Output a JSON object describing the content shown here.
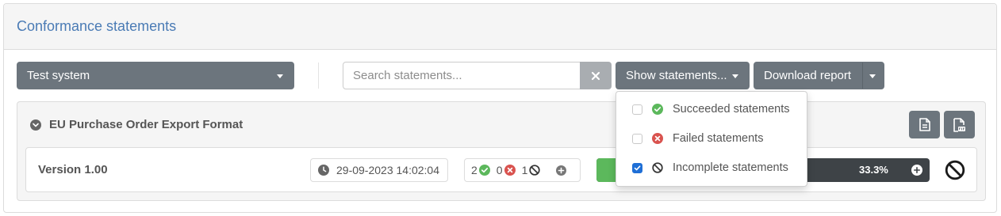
{
  "panel": {
    "title": "Conformance statements"
  },
  "toolbar": {
    "system_select": "Test system",
    "search_placeholder": "Search statements...",
    "show_statements_label": "Show statements...",
    "download_report_label": "Download report"
  },
  "specification": {
    "title": "EU Purchase Order Export Format",
    "version": "Version 1.00",
    "timestamp": "29-09-2023 14:02:04",
    "counts": {
      "succeeded": "2",
      "failed": "0",
      "incomplete": "1"
    },
    "progress": {
      "percent_label": "33.3%",
      "succeeded_fraction": 0.333
    }
  },
  "filter_menu": {
    "items": [
      {
        "label": "Succeeded statements",
        "checked": false,
        "icon": "check-circle-icon"
      },
      {
        "label": "Failed statements",
        "checked": false,
        "icon": "x-circle-icon"
      },
      {
        "label": "Incomplete statements",
        "checked": true,
        "icon": "ban-icon"
      }
    ]
  },
  "colors": {
    "accent_title": "#4a7bb5",
    "button": "#6c757d",
    "success": "#5cb85c",
    "danger": "#d9534f",
    "progress_bg": "#3e4347"
  }
}
